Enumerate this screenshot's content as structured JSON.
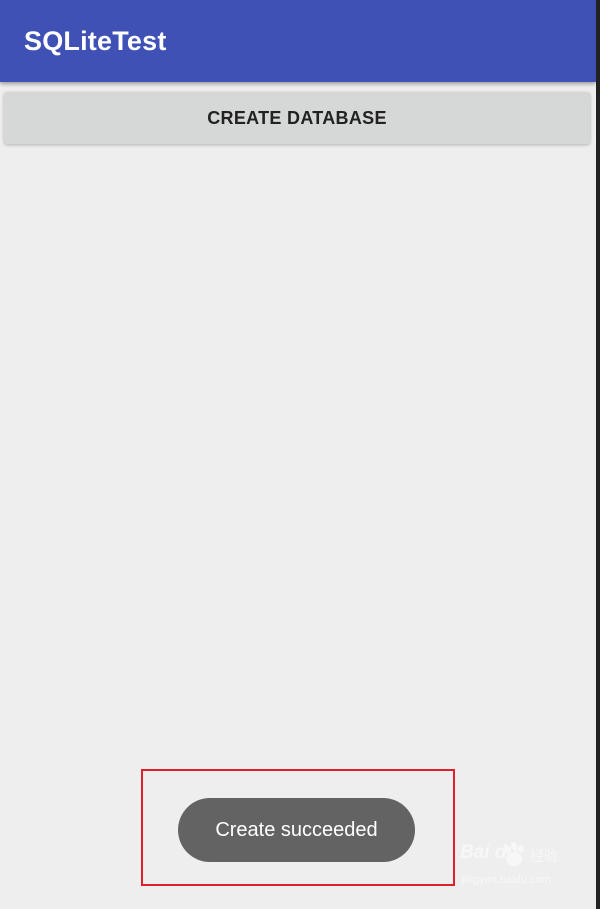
{
  "app_bar": {
    "title": "SQLiteTest",
    "color": "#3f51b5"
  },
  "main": {
    "create_button_label": "CREATE DATABASE",
    "background": "#eeeeee"
  },
  "toast": {
    "message": "Create succeeded",
    "color": "#636363"
  },
  "annotation": {
    "highlight_color": "#e0202a"
  },
  "watermark": {
    "brand": "Bai du",
    "brand_sub": "经验",
    "url": "jingyan.baidu.com",
    "icon": "paw-icon"
  }
}
